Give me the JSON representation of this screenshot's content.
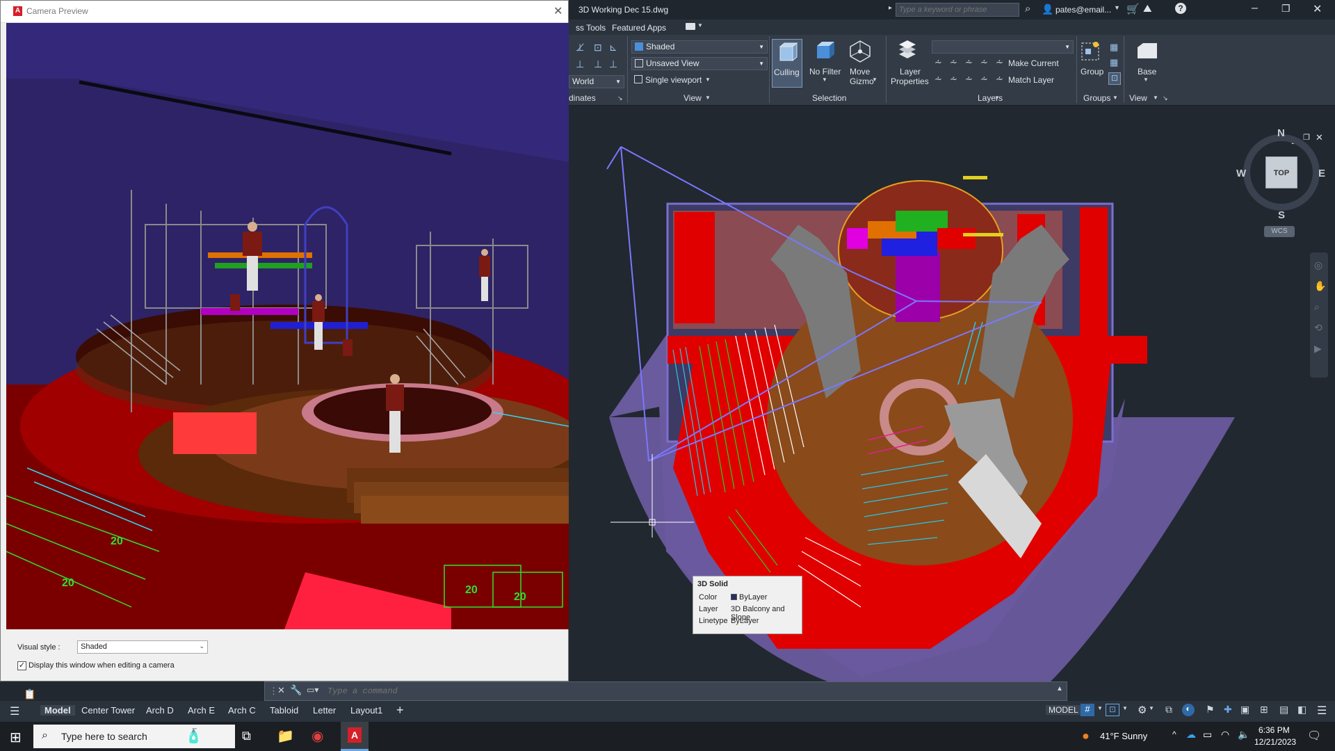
{
  "titlebar": {
    "document_title": "3D Working Dec 15.dwg",
    "search_placeholder": "Type a keyword or phrase",
    "user": "pates@email...",
    "help_icon": "help-icon"
  },
  "ribbon_tabs": {
    "partial_tab": "ss Tools",
    "featured_apps": "Featured Apps"
  },
  "ribbon": {
    "coordinates": {
      "ucs_value": "World",
      "title": "dinates"
    },
    "view": {
      "visual_style": "Shaded",
      "saved_view": "Unsaved View",
      "viewport": "Single viewport",
      "title": "View"
    },
    "selection": {
      "culling": "Culling",
      "no_filter": "No Filter",
      "move_gizmo_1": "Move",
      "move_gizmo_2": "Gizmo",
      "title": "Selection"
    },
    "layers": {
      "layer_properties_1": "Layer",
      "layer_properties_2": "Properties",
      "make_current": "Make Current",
      "match_layer": "Match Layer",
      "title": "Layers"
    },
    "groups": {
      "group": "Group",
      "title": "Groups"
    },
    "view2": {
      "base": "Base",
      "title": "View"
    }
  },
  "viewcube": {
    "north": "N",
    "south": "S",
    "east": "E",
    "west": "W",
    "face": "TOP",
    "wcs": "WCS"
  },
  "tooltip": {
    "title": "3D Solid",
    "rows": [
      {
        "label": "Color",
        "value": "ByLayer"
      },
      {
        "label": "Layer",
        "value": "3D Balcony and Slope"
      },
      {
        "label": "Linetype",
        "value": "ByLayer"
      }
    ]
  },
  "camera_preview": {
    "title": "Camera Preview",
    "visual_style_label": "Visual style :",
    "visual_style_value": "Shaded",
    "display_checkbox_label": "Display this window when editing a camera",
    "display_checked": true,
    "seat_label": "20"
  },
  "command": {
    "placeholder": "Type a command"
  },
  "layout_tabs": [
    "Model",
    "Center Tower",
    "Arch D",
    "Arch E",
    "Arch C",
    "Tabloid",
    "Letter",
    "Layout1"
  ],
  "status": {
    "model": "MODEL"
  },
  "taskbar": {
    "search_placeholder": "Type here to search",
    "weather": "41°F  Sunny",
    "time": "6:36 PM",
    "date": "12/21/2023"
  },
  "colors": {
    "accent_red": "#e60000",
    "ribbon_bg": "#333b46",
    "drawing_bg": "#212830",
    "seating_purple": "#6a5a9e"
  }
}
